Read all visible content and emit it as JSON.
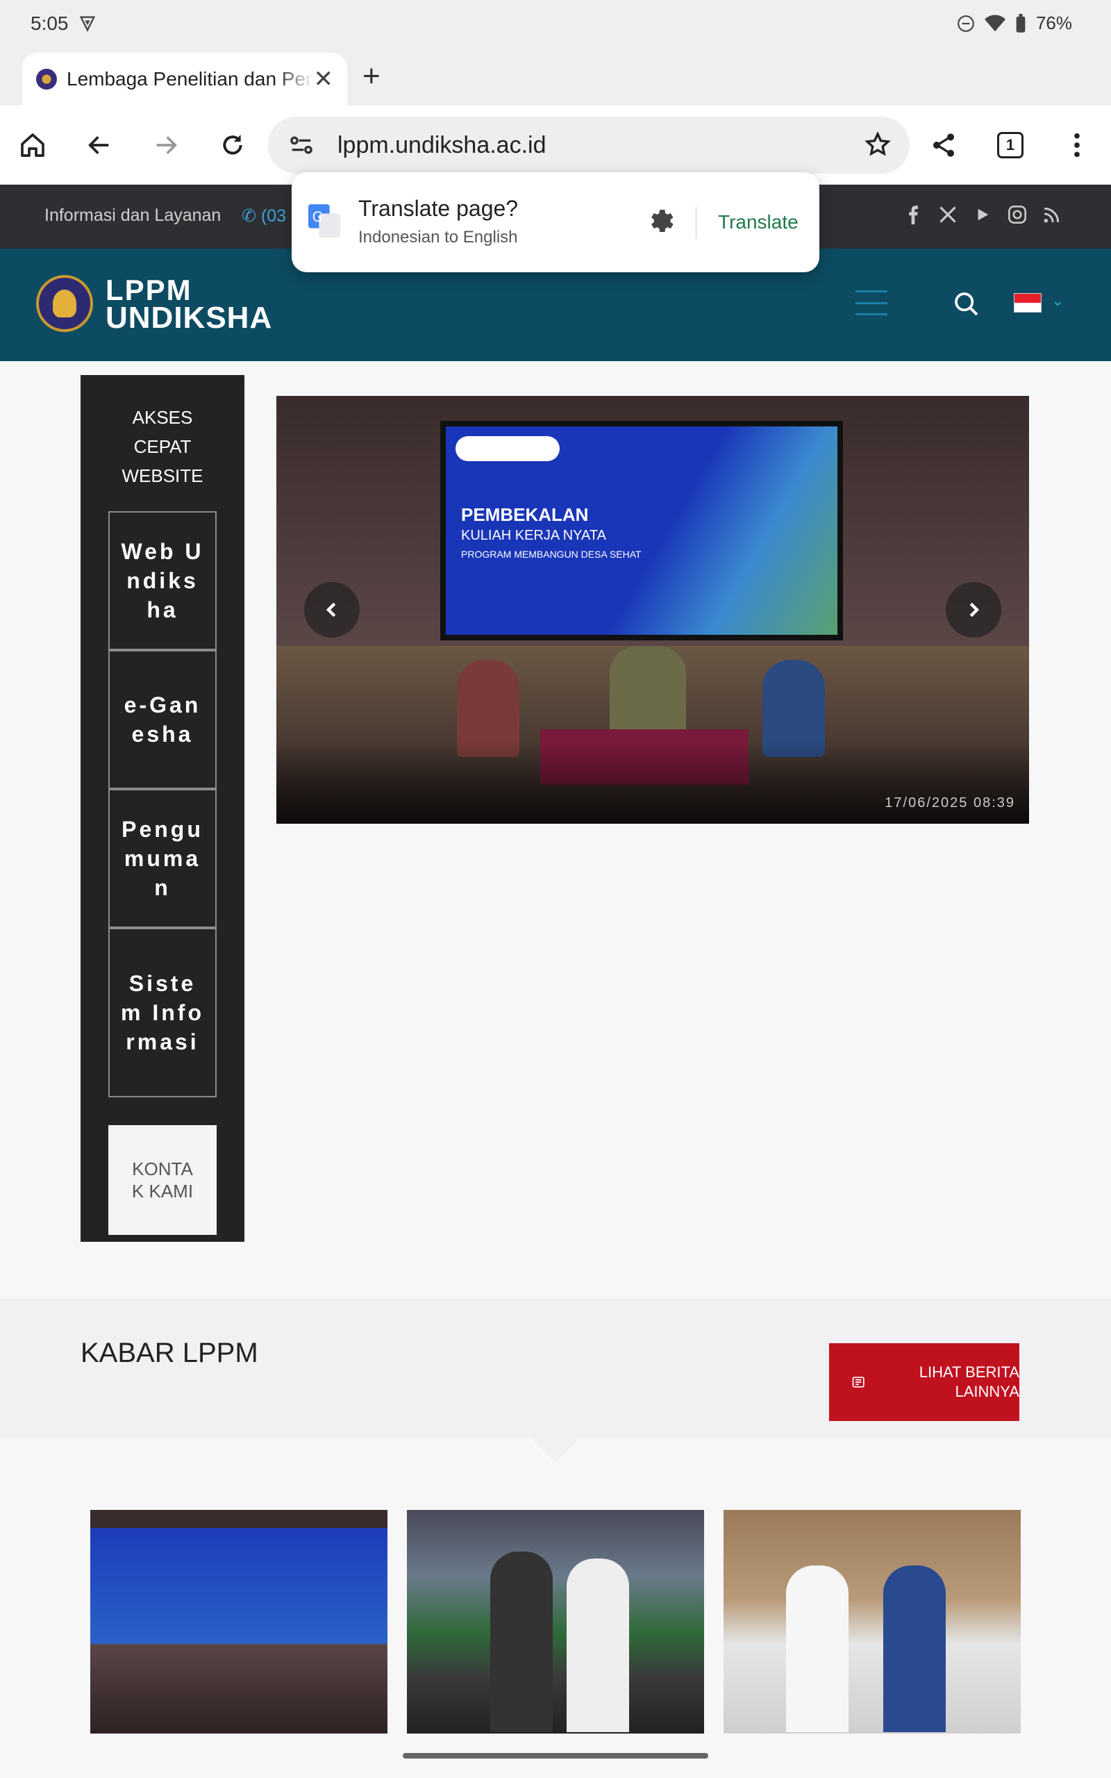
{
  "status": {
    "time": "5:05",
    "battery": "76%"
  },
  "tab": {
    "title": "Lembaga Penelitian dan Pengabdian kepada Masyarakat"
  },
  "toolbar": {
    "url": "lppm.undiksha.ac.id",
    "tab_count": "1"
  },
  "translate": {
    "question": "Translate page?",
    "languages": "Indonesian to English",
    "button": "Translate"
  },
  "infobar": {
    "label": "Informasi dan Layanan",
    "phone": "(03"
  },
  "header": {
    "brand_line1": "LPPM",
    "brand_line2": "UNDIKSHA"
  },
  "quick": {
    "title": "AKSES CEPAT WEBSITE",
    "items": [
      "Web Undiksha",
      "e-Ganesha",
      "Pengumuman",
      "Sistem Informasi"
    ],
    "contact": "KONTAK KAMI"
  },
  "slider": {
    "date": "17/06/2025  08:39",
    "screen_title": "PEMBEKALAN",
    "screen_sub": "KULIAH KERJA NYATA",
    "screen_sub2": "PROGRAM MEMBANGUN DESA SEHAT"
  },
  "kabar": {
    "title": "KABAR LPPM",
    "button": "LIHAT BERITA LAINNYA"
  },
  "colors": {
    "header": "#0d4b62",
    "infobar": "#2e2f33",
    "accent_red": "#c0111f",
    "translate_green": "#1f7a4a"
  }
}
